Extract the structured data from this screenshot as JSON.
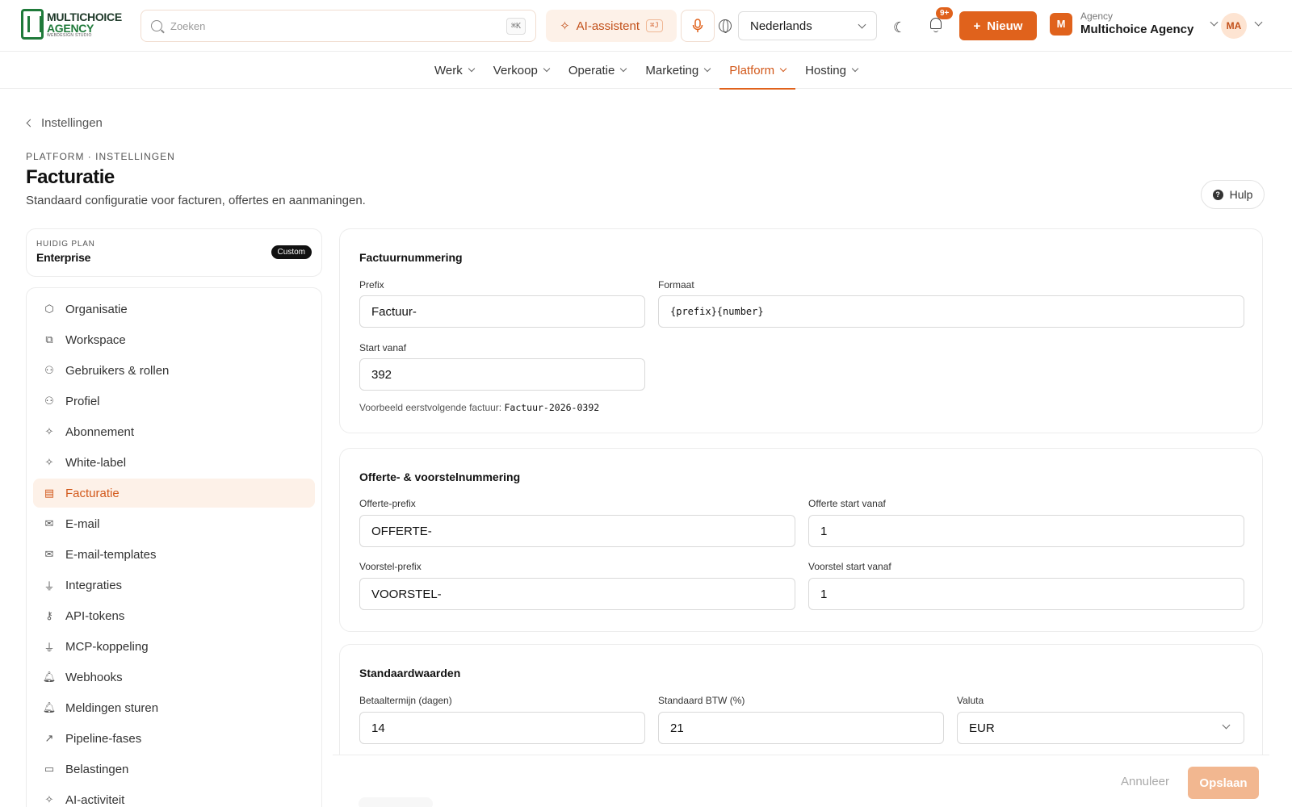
{
  "brand": {
    "line1": "MULTICHOICE",
    "line2": "AGENCY",
    "line3": "WEBDESIGN STUDIO"
  },
  "topbar": {
    "search_placeholder": "Zoeken",
    "search_shortcut": "⌘K",
    "ai_label": "AI-assistent",
    "ai_shortcut": "⌘J",
    "language": "Nederlands",
    "notif_badge": "9+",
    "new_label": "Nieuw",
    "agency_logo": "M",
    "agency_caption": "Agency",
    "agency_name": "Multichoice Agency",
    "avatar_initials": "MA"
  },
  "nav": {
    "items": [
      {
        "label": "Werk"
      },
      {
        "label": "Verkoop"
      },
      {
        "label": "Operatie"
      },
      {
        "label": "Marketing"
      },
      {
        "label": "Platform",
        "active": true
      },
      {
        "label": "Hosting"
      }
    ]
  },
  "header": {
    "breadcrumb": "Instellingen",
    "eyebrow": "PLATFORM · INSTELLINGEN",
    "title": "Facturatie",
    "subtitle": "Standaard configuratie voor facturen, offertes en aanmaningen.",
    "help_label": "Hulp"
  },
  "plan": {
    "label": "HUIDIG PLAN",
    "name": "Enterprise",
    "badge": "Custom"
  },
  "sidebar": {
    "items": [
      {
        "label": "Organisatie",
        "icon": "cube-icon"
      },
      {
        "label": "Workspace",
        "icon": "windows-icon"
      },
      {
        "label": "Gebruikers & rollen",
        "icon": "users-icon"
      },
      {
        "label": "Profiel",
        "icon": "users-icon"
      },
      {
        "label": "Abonnement",
        "icon": "sparkle-icon"
      },
      {
        "label": "White-label",
        "icon": "sparkle-icon"
      },
      {
        "label": "Facturatie",
        "icon": "receipt-icon",
        "active": true
      },
      {
        "label": "E-mail",
        "icon": "mail-icon"
      },
      {
        "label": "E-mail-templates",
        "icon": "mail-icon"
      },
      {
        "label": "Integraties",
        "icon": "plug-icon"
      },
      {
        "label": "API-tokens",
        "icon": "key-icon"
      },
      {
        "label": "MCP-koppeling",
        "icon": "plug-icon"
      },
      {
        "label": "Webhooks",
        "icon": "bell-icon"
      },
      {
        "label": "Meldingen sturen",
        "icon": "bell-icon"
      },
      {
        "label": "Pipeline-fases",
        "icon": "trend-icon"
      },
      {
        "label": "Belastingen",
        "icon": "wallet-icon"
      },
      {
        "label": "AI-activiteit",
        "icon": "sparkle-icon"
      }
    ]
  },
  "invoice_numbering": {
    "title": "Factuurnummering",
    "prefix_label": "Prefix",
    "prefix_value": "Factuur-",
    "format_label": "Formaat",
    "format_value": "{prefix}{number}",
    "start_label": "Start vanaf",
    "start_value": "392",
    "example_label": "Voorbeeld eerstvolgende factuur:",
    "example_value": "Factuur-2026-0392"
  },
  "quote_numbering": {
    "title": "Offerte- & voorstelnummering",
    "quote_prefix_label": "Offerte-prefix",
    "quote_prefix_value": "OFFERTE-",
    "quote_start_label": "Offerte start vanaf",
    "quote_start_value": "1",
    "proposal_prefix_label": "Voorstel-prefix",
    "proposal_prefix_value": "VOORSTEL-",
    "proposal_start_label": "Voorstel start vanaf",
    "proposal_start_value": "1"
  },
  "defaults": {
    "title": "Standaardwaarden",
    "payment_term_label": "Betaaltermijn (dagen)",
    "payment_term_value": "14",
    "vat_label": "Standaard BTW (%)",
    "vat_value": "21",
    "currency_label": "Valuta",
    "currency_value": "EUR"
  },
  "footer": {
    "cancel_label": "Annuleer",
    "save_label": "Opslaan"
  },
  "colors": {
    "accent": "#e0621c",
    "accent_soft": "#fdf1e8",
    "brand_green": "#1f7a3a"
  }
}
